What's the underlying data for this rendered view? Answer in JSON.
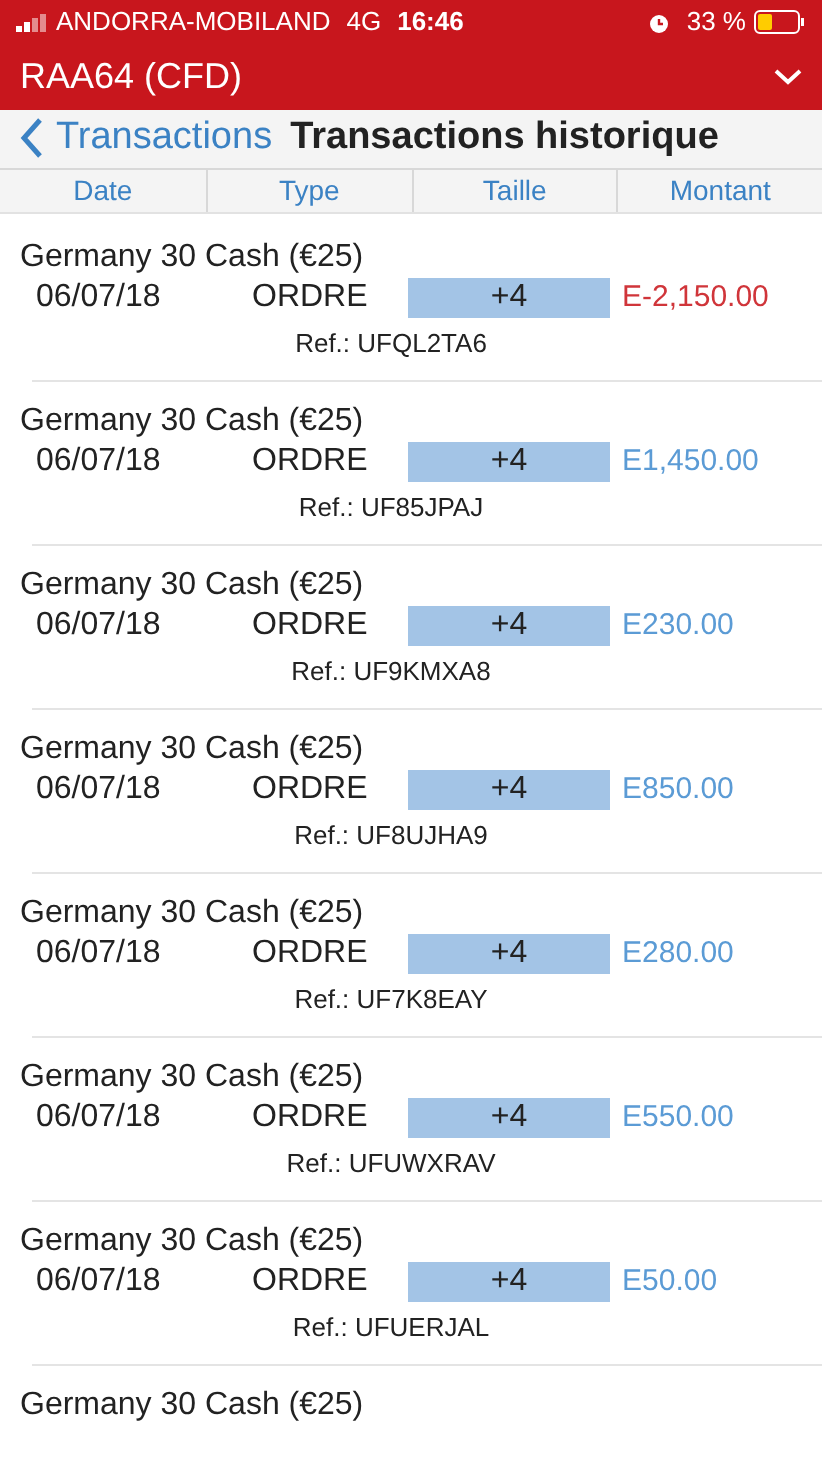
{
  "status_bar": {
    "carrier": "ANDORRA-MOBILAND",
    "network": "4G",
    "time": "16:46",
    "battery": "33 %"
  },
  "account": {
    "title": "RAA64 (CFD)"
  },
  "nav": {
    "back": "Transactions",
    "title": "Transactions historique"
  },
  "columns": [
    "Date",
    "Type",
    "Taille",
    "Montant"
  ],
  "rows": [
    {
      "instrument": "Germany 30 Cash (€25)",
      "date": "06/07/18",
      "type": "ORDRE",
      "size": "+4",
      "amount": "E-2,150.00",
      "kind": "debit",
      "ref": "Ref.: UFQL2TA6"
    },
    {
      "instrument": "Germany 30 Cash (€25)",
      "date": "06/07/18",
      "type": "ORDRE",
      "size": "+4",
      "amount": "E1,450.00",
      "kind": "credit",
      "ref": "Ref.: UF85JPAJ"
    },
    {
      "instrument": "Germany 30 Cash (€25)",
      "date": "06/07/18",
      "type": "ORDRE",
      "size": "+4",
      "amount": "E230.00",
      "kind": "credit",
      "ref": "Ref.: UF9KMXA8"
    },
    {
      "instrument": "Germany 30 Cash (€25)",
      "date": "06/07/18",
      "type": "ORDRE",
      "size": "+4",
      "amount": "E850.00",
      "kind": "credit",
      "ref": "Ref.: UF8UJHA9"
    },
    {
      "instrument": "Germany 30 Cash (€25)",
      "date": "06/07/18",
      "type": "ORDRE",
      "size": "+4",
      "amount": "E280.00",
      "kind": "credit",
      "ref": "Ref.: UF7K8EAY"
    },
    {
      "instrument": "Germany 30 Cash (€25)",
      "date": "06/07/18",
      "type": "ORDRE",
      "size": "+4",
      "amount": "E550.00",
      "kind": "credit",
      "ref": "Ref.: UFUWXRAV"
    },
    {
      "instrument": "Germany 30 Cash (€25)",
      "date": "06/07/18",
      "type": "ORDRE",
      "size": "+4",
      "amount": "E50.00",
      "kind": "credit",
      "ref": "Ref.: UFUERJAL"
    },
    {
      "instrument": "Germany 30 Cash (€25)"
    }
  ]
}
